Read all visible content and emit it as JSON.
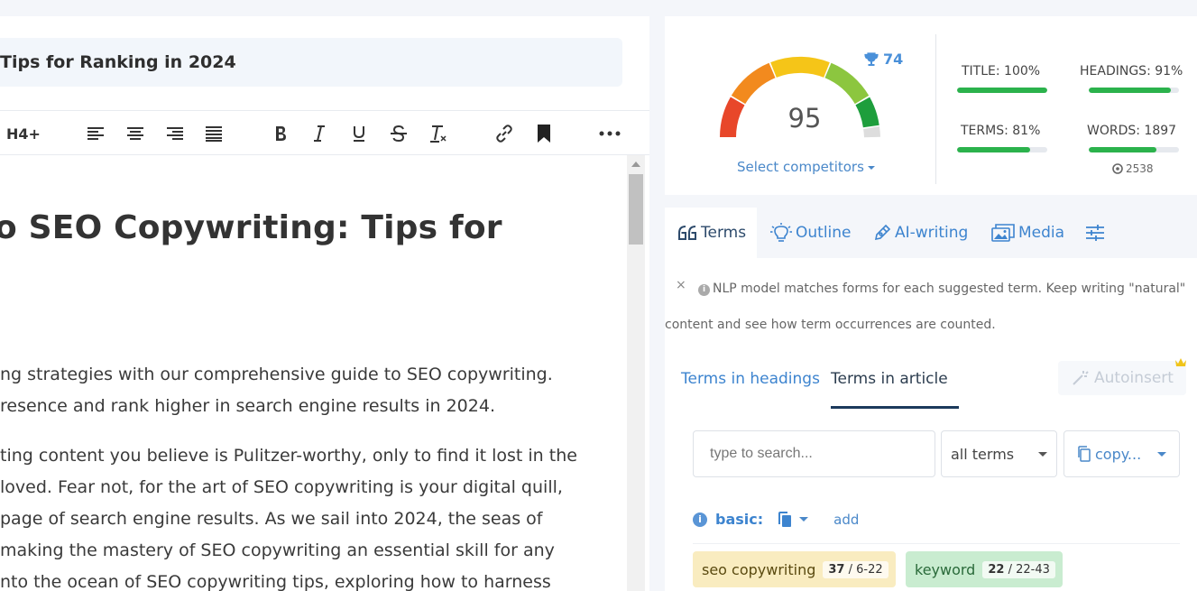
{
  "editor": {
    "title": "Tips for Ranking in 2024",
    "toolbar": {
      "heading_label": "H4+"
    },
    "heading": "o SEO Copywriting: Tips for",
    "paragraphs": [
      "ng strategies with our comprehensive guide to SEO copywriting.",
      "resence and rank higher in search engine results in 2024.",
      "ting content you believe is Pulitzer-worthy, only to find it lost in the",
      "loved. Fear not, for the art of SEO copywriting is your digital quill,",
      " page of search engine results. As we sail into 2024, the seas of",
      "making the mastery of SEO copywriting an essential skill for any",
      "nto the ocean of SEO copywriting tips, exploring how to harness"
    ]
  },
  "score": {
    "value": "95",
    "trophy_value": "74",
    "select_competitors": "Select competitors",
    "metrics": {
      "title": {
        "label": "TITLE: 100%",
        "fill": 1.0
      },
      "headings": {
        "label": "HEADINGS: 91%",
        "fill": 0.91
      },
      "terms": {
        "label": "TERMS: 81%",
        "fill": 0.81
      },
      "words": {
        "label": "WORDS: 1897",
        "fill": 0.75,
        "sub": "2538"
      }
    }
  },
  "tabs": {
    "items": [
      "Terms",
      "Outline",
      "AI-writing",
      "Media"
    ],
    "info": "NLP model matches forms for each suggested term. Keep writing \"natural\" content and see how term occurrences are counted.",
    "close": "×",
    "subtabs": [
      "Terms in headings",
      "Terms in article"
    ],
    "autoinsert": "Autoinsert",
    "search_placeholder": "type to search...",
    "filter_value": "all terms",
    "copy_label": "copy...",
    "basic_label": "basic:",
    "add_label": "add",
    "chips": [
      {
        "term": "seo copywriting",
        "count": "37",
        "range": "6-22",
        "bg": "#f9ecc0",
        "color": "#5a4a10"
      },
      {
        "term": "keyword",
        "count": "22",
        "range": "22-43",
        "bg": "#c9ecd0",
        "color": "#2a6a3a"
      }
    ]
  },
  "colors": {
    "accent": "#3d84cf",
    "gauge": [
      "#e8472a",
      "#f28a1e",
      "#f5c518",
      "#8cc63f",
      "#1e9e3c",
      "#dddddd"
    ],
    "bar_fill": "#2bb24c"
  }
}
